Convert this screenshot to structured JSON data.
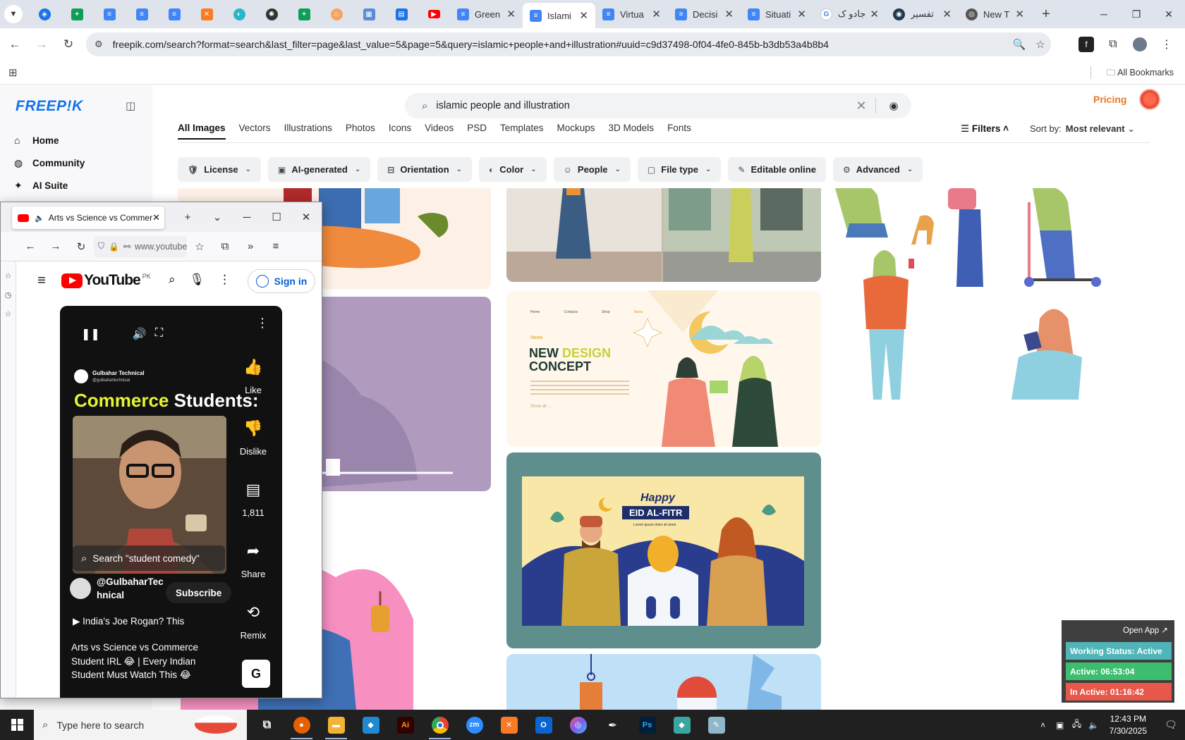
{
  "chrome": {
    "tabs": [
      {
        "label": "Green",
        "icon": "docs",
        "active": false
      },
      {
        "label": "Islami",
        "icon": "docs",
        "active": true
      },
      {
        "label": "Virtua",
        "icon": "docs",
        "active": false
      },
      {
        "label": "Decisi",
        "icon": "docs",
        "active": false
      },
      {
        "label": "Situati",
        "icon": "docs",
        "active": false
      },
      {
        "label": "جادو ک",
        "icon": "google",
        "active": false
      },
      {
        "label": "تفسیر",
        "icon": "site",
        "active": false
      },
      {
        "label": "New T",
        "icon": "chrome",
        "active": false
      }
    ],
    "url": "freepik.com/search?format=search&last_filter=page&last_value=5&page=5&query=islamic+people+and+illustration#uuid=c9d37498-0f04-4fe0-845b-b3db53a4b8b4",
    "bookmarks_label": "All Bookmarks"
  },
  "freepik": {
    "logo": "FREEP!K",
    "nav": [
      {
        "label": "Home",
        "icon": "home-icon"
      },
      {
        "label": "Community",
        "icon": "globe-icon"
      },
      {
        "label": "AI Suite",
        "icon": "sparkle-icon"
      }
    ],
    "search_query": "islamic people and illustration",
    "pricing": "Pricing",
    "tabs": [
      "All Images",
      "Vectors",
      "Illustrations",
      "Photos",
      "Icons",
      "Videos",
      "PSD",
      "Templates",
      "Mockups",
      "3D Models",
      "Fonts"
    ],
    "filters_label": "Filters",
    "sort_label": "Sort by:",
    "sort_value": "Most relevant",
    "chips": [
      {
        "label": "License",
        "icon": "🛡"
      },
      {
        "label": "AI-generated",
        "icon": "▣"
      },
      {
        "label": "Orientation",
        "icon": "⊟"
      },
      {
        "label": "Color",
        "icon": "◐"
      },
      {
        "label": "People",
        "icon": "☺"
      },
      {
        "label": "File type",
        "icon": "▢"
      },
      {
        "label": "Editable online",
        "icon": "✎"
      },
      {
        "label": "Advanced",
        "icon": "⚙"
      }
    ],
    "cards": {
      "design_concept_title_1": "NEW ",
      "design_concept_title_2": "DESIGN",
      "design_concept_title_3": "CONCEPT",
      "eid_happy": "Happy",
      "eid_title": "EID AL-FITR",
      "eid_sub": "Lorem ipsum dolor sit amet",
      "landing_nav": [
        "Home",
        "Contacts",
        "Shop",
        "News"
      ],
      "landing_news": "News",
      "landing_more": "Show all →"
    }
  },
  "firefox": {
    "tab_title": "Arts vs Science vs Commerce Student IRL",
    "url": "www.youtube.com"
  },
  "youtube": {
    "logo_text": "YouTube",
    "country": "PK",
    "sign_in": "Sign in",
    "short": {
      "channel_small": "Gulbahar Technical",
      "channel_handle_small": "@gulbahartechnical",
      "headline_a": "Commerce",
      "headline_b": " Students:",
      "like": "Like",
      "dislike": "Dislike",
      "comments": "1,811",
      "share": "Share",
      "remix": "Remix",
      "search_hint": "Search \"student comedy\"",
      "channel": "@GulbaharTechnical",
      "subscribe": "Subscribe",
      "desc_line": "India's Joe Rogan? This",
      "title": "Arts vs Science vs Commerce Student IRL 😂 | Every Indian Student Must Watch This 😂"
    }
  },
  "status_widget": {
    "open_app": "Open App ↗",
    "working_status": "Working Status: Active",
    "active": "Active: 06:53:04",
    "inactive": "In Active: 01:16:42"
  },
  "taskbar": {
    "search_placeholder": "Type here to search",
    "time": "12:43 PM",
    "date": "7/30/2025",
    "apps": [
      {
        "name": "task-view",
        "label": "⧉",
        "color": "#202020"
      },
      {
        "name": "firefox",
        "label": "🦊",
        "color": "#e66000"
      },
      {
        "name": "file-explorer",
        "label": "▬",
        "color": "#f2b233"
      },
      {
        "name": "vscode",
        "label": "◆",
        "color": "#1f8ad2"
      },
      {
        "name": "illustrator",
        "label": "Ai",
        "color": "#330000"
      },
      {
        "name": "chrome",
        "label": "●",
        "color": "#1a73e8"
      },
      {
        "name": "zoom",
        "label": "zm",
        "color": "#2d8cff"
      },
      {
        "name": "xampp",
        "label": "✕",
        "color": "#fb7a24"
      },
      {
        "name": "outlook",
        "label": "O",
        "color": "#0a64d2"
      },
      {
        "name": "paint",
        "label": "◎",
        "color": "#b14fd8"
      },
      {
        "name": "pen-tool",
        "label": "✒",
        "color": "#202020"
      },
      {
        "name": "photoshop",
        "label": "Ps",
        "color": "#001e36"
      },
      {
        "name": "app-gem",
        "label": "◆",
        "color": "#3aa6a0"
      },
      {
        "name": "app-note",
        "label": "✎",
        "color": "#8fb6c9"
      }
    ]
  }
}
